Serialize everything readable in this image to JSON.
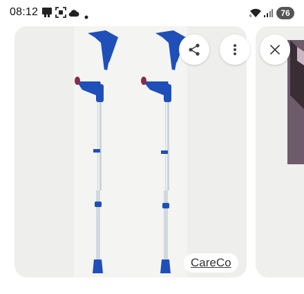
{
  "status_bar": {
    "time": "08:12",
    "icons": [
      "notification-app-icon",
      "screenshot-icon",
      "cloud-icon",
      "dot-icon",
      "wifi-icon",
      "signal-icon"
    ],
    "battery_level": "76"
  },
  "image_viewer": {
    "source_label": "CareCo",
    "actions": {
      "share_icon": "share-icon",
      "more_icon": "more-vert-icon",
      "close_icon": "close-icon"
    }
  },
  "colors": {
    "crutch_blue": "#1f4fb8",
    "crutch_silver": "#d7dde3",
    "card_background": "#eeeeec"
  }
}
